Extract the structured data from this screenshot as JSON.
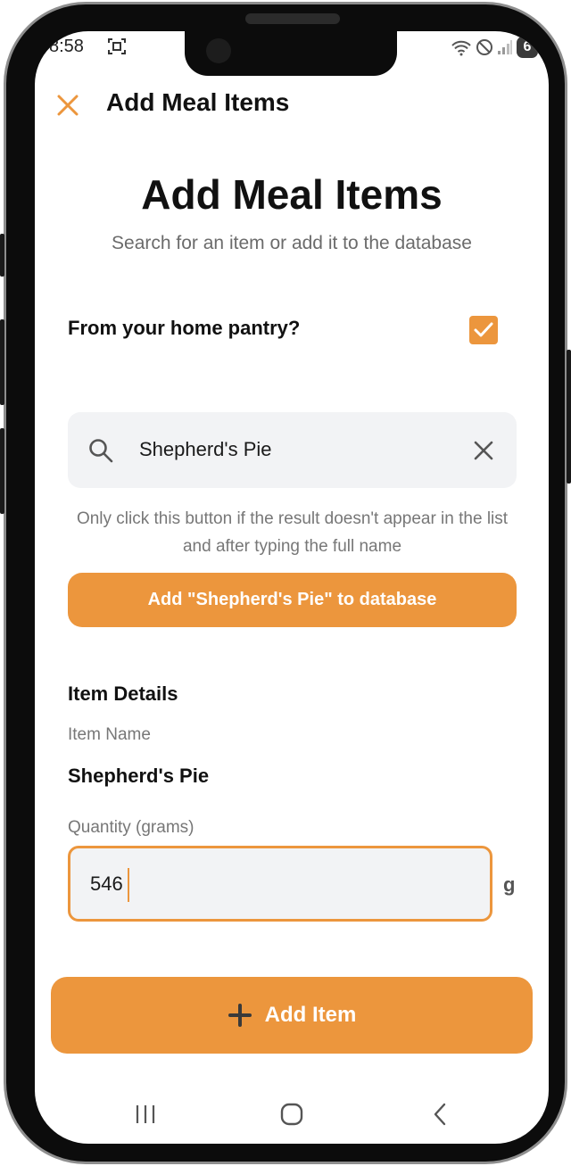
{
  "status_bar": {
    "time": "8:58",
    "battery": "6"
  },
  "header": {
    "title": "Add Meal Items"
  },
  "main": {
    "title": "Add Meal Items",
    "subtitle": "Search for an item or add it to the database",
    "pantry_question": "From your home pantry?",
    "pantry_checked": true,
    "search": {
      "value": "Shepherd's Pie"
    },
    "hint": "Only click this button if the result doesn't appear in the list and after typing the full name",
    "add_to_db_label": "Add \"Shepherd's Pie\" to database"
  },
  "item_details": {
    "section_title": "Item Details",
    "name_label": "Item Name",
    "name_value": "Shepherd's Pie",
    "quantity_label": "Quantity (grams)",
    "quantity_value": "546",
    "unit": "g"
  },
  "actions": {
    "add_item_label": "Add Item"
  },
  "theme": {
    "accent": "#ec963d"
  }
}
